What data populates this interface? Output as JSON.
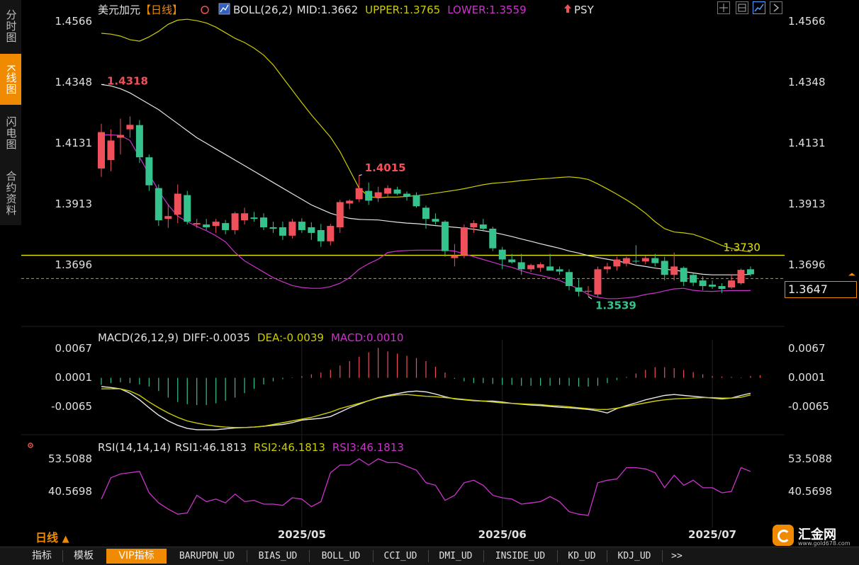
{
  "sidebar": {
    "tabs": [
      {
        "label": "分时图",
        "active": false
      },
      {
        "label": "K线图",
        "active": true
      },
      {
        "label": "闪电图",
        "active": false
      },
      {
        "label": "合约资料",
        "active": false
      }
    ]
  },
  "header": {
    "symbol": "美元加元",
    "period_tag": "【日线】",
    "boll_label": "BOLL(26,2)",
    "mid_label": "MID:1.3662",
    "upper_label": "UPPER:1.3765",
    "lower_label": "LOWER:1.3559",
    "psy_label": "PSY"
  },
  "colors": {
    "up": "#f0505a",
    "down": "#36c28c",
    "mid": "#e6e6e6",
    "upper": "#cccc00",
    "lower": "#cc33cc",
    "accent": "#f08a00",
    "hline": "#e6e600"
  },
  "chart_data": [
    {
      "type": "candlestick",
      "title": "美元加元【日线】",
      "y_ticks": [
        "1.4566",
        "1.4348",
        "1.4131",
        "1.3913",
        "1.3696"
      ],
      "ylim": [
        1.3505,
        1.4617
      ],
      "x_tick_labels": [
        "2025/05",
        "2025/06",
        "2025/07"
      ],
      "x_tick_index": [
        21,
        42,
        64
      ],
      "candles": [
        {
          "o": 1.404,
          "h": 1.42,
          "l": 1.401,
          "c": 1.417
        },
        {
          "o": 1.407,
          "h": 1.418,
          "l": 1.403,
          "c": 1.414
        },
        {
          "o": 1.415,
          "h": 1.4218,
          "l": 1.409,
          "c": 1.416
        },
        {
          "o": 1.418,
          "h": 1.4226,
          "l": 1.415,
          "c": 1.4196
        },
        {
          "o": 1.4195,
          "h": 1.4213,
          "l": 1.406,
          "c": 1.408
        },
        {
          "o": 1.408,
          "h": 1.409,
          "l": 1.396,
          "c": 1.398
        },
        {
          "o": 1.397,
          "h": 1.3983,
          "l": 1.3835,
          "c": 1.3855
        },
        {
          "o": 1.386,
          "h": 1.3912,
          "l": 1.3828,
          "c": 1.387
        },
        {
          "o": 1.3875,
          "h": 1.3983,
          "l": 1.3845,
          "c": 1.395
        },
        {
          "o": 1.3945,
          "h": 1.396,
          "l": 1.384,
          "c": 1.385
        },
        {
          "o": 1.384,
          "h": 1.386,
          "l": 1.3828,
          "c": 1.3845
        },
        {
          "o": 1.384,
          "h": 1.386,
          "l": 1.382,
          "c": 1.383
        },
        {
          "o": 1.3835,
          "h": 1.386,
          "l": 1.381,
          "c": 1.385
        },
        {
          "o": 1.3845,
          "h": 1.3856,
          "l": 1.3805,
          "c": 1.382
        },
        {
          "o": 1.382,
          "h": 1.3885,
          "l": 1.3805,
          "c": 1.388
        },
        {
          "o": 1.3855,
          "h": 1.39,
          "l": 1.384,
          "c": 1.388
        },
        {
          "o": 1.3865,
          "h": 1.3885,
          "l": 1.385,
          "c": 1.386
        },
        {
          "o": 1.3865,
          "h": 1.388,
          "l": 1.382,
          "c": 1.383
        },
        {
          "o": 1.383,
          "h": 1.385,
          "l": 1.381,
          "c": 1.3825
        },
        {
          "o": 1.383,
          "h": 1.385,
          "l": 1.3785,
          "c": 1.38
        },
        {
          "o": 1.38,
          "h": 1.386,
          "l": 1.379,
          "c": 1.385
        },
        {
          "o": 1.385,
          "h": 1.3862,
          "l": 1.381,
          "c": 1.382
        },
        {
          "o": 1.383,
          "h": 1.3848,
          "l": 1.3785,
          "c": 1.381
        },
        {
          "o": 1.382,
          "h": 1.3842,
          "l": 1.376,
          "c": 1.378
        },
        {
          "o": 1.378,
          "h": 1.3842,
          "l": 1.3765,
          "c": 1.3835
        },
        {
          "o": 1.383,
          "h": 1.3928,
          "l": 1.381,
          "c": 1.392
        },
        {
          "o": 1.3915,
          "h": 1.393,
          "l": 1.3895,
          "c": 1.3925
        },
        {
          "o": 1.393,
          "h": 1.4015,
          "l": 1.392,
          "c": 1.397
        },
        {
          "o": 1.396,
          "h": 1.399,
          "l": 1.391,
          "c": 1.3925
        },
        {
          "o": 1.3935,
          "h": 1.3975,
          "l": 1.392,
          "c": 1.3955
        },
        {
          "o": 1.395,
          "h": 1.398,
          "l": 1.394,
          "c": 1.397
        },
        {
          "o": 1.3965,
          "h": 1.3975,
          "l": 1.3945,
          "c": 1.395
        },
        {
          "o": 1.395,
          "h": 1.3958,
          "l": 1.3925,
          "c": 1.394
        },
        {
          "o": 1.3945,
          "h": 1.3955,
          "l": 1.39,
          "c": 1.3905
        },
        {
          "o": 1.39,
          "h": 1.3908,
          "l": 1.3825,
          "c": 1.386
        },
        {
          "o": 1.386,
          "h": 1.388,
          "l": 1.384,
          "c": 1.385
        },
        {
          "o": 1.385,
          "h": 1.3855,
          "l": 1.3725,
          "c": 1.3745
        },
        {
          "o": 1.372,
          "h": 1.377,
          "l": 1.369,
          "c": 1.373
        },
        {
          "o": 1.373,
          "h": 1.384,
          "l": 1.372,
          "c": 1.383
        },
        {
          "o": 1.383,
          "h": 1.3855,
          "l": 1.381,
          "c": 1.3845
        },
        {
          "o": 1.384,
          "h": 1.386,
          "l": 1.3815,
          "c": 1.3825
        },
        {
          "o": 1.3825,
          "h": 1.3832,
          "l": 1.3745,
          "c": 1.3755
        },
        {
          "o": 1.375,
          "h": 1.376,
          "l": 1.368,
          "c": 1.3715
        },
        {
          "o": 1.3715,
          "h": 1.3735,
          "l": 1.37,
          "c": 1.3705
        },
        {
          "o": 1.3705,
          "h": 1.3735,
          "l": 1.366,
          "c": 1.368
        },
        {
          "o": 1.368,
          "h": 1.37,
          "l": 1.367,
          "c": 1.3695
        },
        {
          "o": 1.3685,
          "h": 1.3705,
          "l": 1.367,
          "c": 1.3698
        },
        {
          "o": 1.369,
          "h": 1.3735,
          "l": 1.368,
          "c": 1.3675
        },
        {
          "o": 1.368,
          "h": 1.369,
          "l": 1.366,
          "c": 1.3672
        },
        {
          "o": 1.367,
          "h": 1.368,
          "l": 1.3605,
          "c": 1.362
        },
        {
          "o": 1.3615,
          "h": 1.3645,
          "l": 1.3583,
          "c": 1.36
        },
        {
          "o": 1.36,
          "h": 1.362,
          "l": 1.3585,
          "c": 1.3603
        },
        {
          "o": 1.359,
          "h": 1.369,
          "l": 1.358,
          "c": 1.368
        },
        {
          "o": 1.368,
          "h": 1.3703,
          "l": 1.3665,
          "c": 1.369
        },
        {
          "o": 1.369,
          "h": 1.3725,
          "l": 1.3675,
          "c": 1.3715
        },
        {
          "o": 1.37,
          "h": 1.3725,
          "l": 1.369,
          "c": 1.372
        },
        {
          "o": 1.371,
          "h": 1.3766,
          "l": 1.37,
          "c": 1.3708
        },
        {
          "o": 1.3708,
          "h": 1.3728,
          "l": 1.3698,
          "c": 1.372
        },
        {
          "o": 1.372,
          "h": 1.3735,
          "l": 1.369,
          "c": 1.3702
        },
        {
          "o": 1.371,
          "h": 1.3725,
          "l": 1.364,
          "c": 1.366
        },
        {
          "o": 1.366,
          "h": 1.374,
          "l": 1.364,
          "c": 1.369
        },
        {
          "o": 1.3685,
          "h": 1.369,
          "l": 1.362,
          "c": 1.3635
        },
        {
          "o": 1.366,
          "h": 1.3665,
          "l": 1.362,
          "c": 1.3632
        },
        {
          "o": 1.364,
          "h": 1.3655,
          "l": 1.3605,
          "c": 1.362
        },
        {
          "o": 1.3625,
          "h": 1.364,
          "l": 1.361,
          "c": 1.3618
        },
        {
          "o": 1.362,
          "h": 1.363,
          "l": 1.3595,
          "c": 1.361
        },
        {
          "o": 1.3615,
          "h": 1.366,
          "l": 1.361,
          "c": 1.364
        },
        {
          "o": 1.363,
          "h": 1.3682,
          "l": 1.3625,
          "c": 1.3678
        },
        {
          "o": 1.368,
          "h": 1.369,
          "l": 1.3655,
          "c": 1.3662
        }
      ],
      "boll_mid": [
        1.434,
        1.4335,
        1.4325,
        1.431,
        1.429,
        1.427,
        1.425,
        1.4225,
        1.42,
        1.4175,
        1.415,
        1.413,
        1.411,
        1.409,
        1.407,
        1.405,
        1.403,
        1.401,
        1.399,
        1.397,
        1.395,
        1.393,
        1.391,
        1.3895,
        1.388,
        1.387,
        1.3862,
        1.3858,
        1.3857,
        1.3856,
        1.3852,
        1.3848,
        1.3845,
        1.3843,
        1.384,
        1.3836,
        1.3833,
        1.383,
        1.3827,
        1.3823,
        1.3818,
        1.3812,
        1.3805,
        1.3797,
        1.3788,
        1.378,
        1.3771,
        1.3763,
        1.3755,
        1.3745,
        1.3738,
        1.3729,
        1.3722,
        1.3716,
        1.371,
        1.3703,
        1.3695,
        1.369,
        1.3684,
        1.368,
        1.3677,
        1.3672,
        1.3667,
        1.3662,
        1.366,
        1.366,
        1.366,
        1.366,
        1.3662
      ],
      "boll_upper": [
        1.4523,
        1.452,
        1.4513,
        1.45,
        1.4495,
        1.451,
        1.453,
        1.4555,
        1.457,
        1.4573,
        1.4568,
        1.456,
        1.4545,
        1.4525,
        1.4505,
        1.449,
        1.447,
        1.4445,
        1.441,
        1.4365,
        1.432,
        1.4275,
        1.4232,
        1.4192,
        1.4152,
        1.41,
        1.4035,
        1.397,
        1.394,
        1.3935,
        1.3938,
        1.3938,
        1.394,
        1.3943,
        1.3947,
        1.3952,
        1.3957,
        1.3962,
        1.3968,
        1.3975,
        1.3982,
        1.3987,
        1.399,
        1.3993,
        1.3997,
        1.4,
        1.4003,
        1.4005,
        1.4008,
        1.401,
        1.4007,
        1.4001,
        1.3985,
        1.3967,
        1.3948,
        1.3928,
        1.3906,
        1.388,
        1.385,
        1.3825,
        1.3813,
        1.381,
        1.3805,
        1.3793,
        1.378,
        1.3765,
        1.3755,
        1.3747,
        1.3742
      ],
      "boll_lower": [
        1.416,
        1.416,
        1.4158,
        1.414,
        1.408,
        1.402,
        1.396,
        1.391,
        1.387,
        1.385,
        1.3833,
        1.3818,
        1.38,
        1.3778,
        1.374,
        1.371,
        1.369,
        1.367,
        1.365,
        1.3635,
        1.3622,
        1.3615,
        1.3612,
        1.3612,
        1.3618,
        1.363,
        1.365,
        1.368,
        1.37,
        1.3716,
        1.374,
        1.3745,
        1.3747,
        1.3748,
        1.3748,
        1.3748,
        1.3748,
        1.3745,
        1.3735,
        1.3725,
        1.3715,
        1.3705,
        1.3695,
        1.3687,
        1.3675,
        1.3665,
        1.3658,
        1.365,
        1.364,
        1.3625,
        1.361,
        1.359,
        1.358,
        1.3575,
        1.3575,
        1.3578,
        1.3582,
        1.359,
        1.3595,
        1.3603,
        1.361,
        1.3612,
        1.3605,
        1.3602,
        1.3601,
        1.3603,
        1.3604,
        1.3604,
        1.3604
      ],
      "hline": 1.373,
      "hline_label": "1.3730",
      "last_price": 1.3647,
      "last_price_label": "1.3647",
      "high_label": "1.4318",
      "high_point": {
        "index": 0,
        "value": 1.434
      },
      "mid_high_label": "1.4015",
      "mid_high_point": {
        "index": 27,
        "value": 1.4015
      },
      "low_label": "1.3539",
      "low_point": {
        "index": 51,
        "value": 1.3583
      }
    },
    {
      "type": "bar+line",
      "title": "MACD(26,12,9)",
      "diff_label": "DIFF:-0.0035",
      "dea_label": "DEA:-0.0039",
      "macd_label": "MACD:0.0010",
      "y_ticks": [
        "0.0067",
        "0.0001",
        "-0.0065"
      ],
      "ylim": [
        -0.013,
        0.0067
      ],
      "macd": [
        -0.0016,
        -0.0012,
        -0.001,
        -0.0012,
        -0.0015,
        -0.002,
        -0.003,
        -0.0045,
        -0.0055,
        -0.006,
        -0.0062,
        -0.0062,
        -0.0058,
        -0.0052,
        -0.0045,
        -0.0035,
        -0.0025,
        -0.0015,
        -0.0008,
        -0.0003,
        0.0001,
        0.0004,
        0.0008,
        0.0012,
        0.0018,
        0.0028,
        0.0038,
        0.0048,
        0.0058,
        0.0068,
        0.006,
        0.0055,
        0.005,
        0.0045,
        0.0038,
        0.0025,
        0.0012,
        -0.0002,
        -0.0008,
        -0.0012,
        -0.0012,
        -0.0014,
        -0.0016,
        -0.0016,
        -0.0018,
        -0.0018,
        -0.0018,
        -0.0018,
        -0.0016,
        -0.0018,
        -0.002,
        -0.002,
        -0.0018,
        -0.0012,
        -0.0005,
        0.0002,
        0.001,
        0.0018,
        0.0024,
        0.0024,
        0.0022,
        0.0018,
        0.0013,
        0.0008,
        0.0004,
        0.0003,
        0.0002,
        0.0001,
        0.0004,
        0.0006
      ],
      "diff": [
        -0.002,
        -0.0022,
        -0.0025,
        -0.0035,
        -0.005,
        -0.0068,
        -0.0085,
        -0.0098,
        -0.0108,
        -0.0115,
        -0.0118,
        -0.0118,
        -0.0118,
        -0.0116,
        -0.0114,
        -0.0113,
        -0.0112,
        -0.011,
        -0.0108,
        -0.0106,
        -0.0102,
        -0.0096,
        -0.0094,
        -0.0092,
        -0.0088,
        -0.0078,
        -0.0068,
        -0.006,
        -0.0052,
        -0.0045,
        -0.004,
        -0.0036,
        -0.0032,
        -0.003,
        -0.0032,
        -0.0037,
        -0.0043,
        -0.0048,
        -0.005,
        -0.0052,
        -0.0053,
        -0.0053,
        -0.0055,
        -0.0058,
        -0.006,
        -0.0062,
        -0.0063,
        -0.0065,
        -0.0067,
        -0.0068,
        -0.007,
        -0.0072,
        -0.0075,
        -0.008,
        -0.007,
        -0.0063,
        -0.0057,
        -0.005,
        -0.0045,
        -0.004,
        -0.0038,
        -0.004,
        -0.0042,
        -0.0044,
        -0.0046,
        -0.0048,
        -0.0046,
        -0.004,
        -0.0035
      ],
      "dea": [
        -0.0025,
        -0.0025,
        -0.0025,
        -0.003,
        -0.004,
        -0.0055,
        -0.0068,
        -0.008,
        -0.009,
        -0.0098,
        -0.0103,
        -0.0107,
        -0.011,
        -0.0112,
        -0.0113,
        -0.0113,
        -0.0112,
        -0.011,
        -0.0106,
        -0.0102,
        -0.0098,
        -0.0094,
        -0.009,
        -0.0084,
        -0.0078,
        -0.007,
        -0.0064,
        -0.0058,
        -0.0052,
        -0.0046,
        -0.0042,
        -0.0039,
        -0.0038,
        -0.004,
        -0.0042,
        -0.0043,
        -0.0045,
        -0.0047,
        -0.0049,
        -0.0051,
        -0.0053,
        -0.0055,
        -0.0057,
        -0.0058,
        -0.0059,
        -0.006,
        -0.0061,
        -0.0063,
        -0.0064,
        -0.0066,
        -0.0068,
        -0.007,
        -0.0072,
        -0.0072,
        -0.0069,
        -0.0065,
        -0.0061,
        -0.0057,
        -0.0053,
        -0.005,
        -0.0048,
        -0.0047,
        -0.0046,
        -0.0045,
        -0.0045,
        -0.0046,
        -0.0046,
        -0.0044,
        -0.0039
      ]
    },
    {
      "type": "line",
      "title": "RSI(14,14,14)",
      "rsi1_label": "RSI1:46.1813",
      "rsi2_label": "RSI2:46.1813",
      "rsi3_label": "RSI3:46.1813",
      "y_ticks": [
        "53.5088",
        "40.5698"
      ],
      "ylim": [
        25.5,
        57.0
      ],
      "rsi": [
        37.5,
        46,
        47.5,
        48,
        48.5,
        40,
        36,
        33.5,
        31.5,
        32,
        39,
        36.5,
        37.5,
        36,
        39.5,
        36.5,
        37,
        35.5,
        35.5,
        35,
        38,
        37.5,
        34.5,
        36.5,
        48,
        51,
        51,
        53.5,
        51,
        53.5,
        52,
        52,
        50.5,
        49,
        44,
        43,
        37,
        39,
        44,
        45,
        43,
        39,
        38,
        37.5,
        35.5,
        36,
        36.5,
        38.5,
        36.5,
        32.5,
        31.5,
        31,
        44,
        45,
        45.5,
        50,
        50,
        49.5,
        48,
        42,
        47,
        43,
        45,
        42,
        42,
        40,
        40.5,
        50,
        48.5
      ]
    }
  ],
  "bottom_tabs": {
    "period": "日线",
    "period_arrow": "▲",
    "items": [
      "指标",
      "模板",
      "VIP指标",
      "BARUPDN_UD",
      "BIAS_UD",
      "BOLL_UD",
      "CCI_UD",
      "DMI_UD",
      "INSIDE_UD",
      "KD_UD",
      "KDJ_UD",
      ">>"
    ]
  },
  "toolbar_icons": [
    "crosshair-icon",
    "chart-settings-icon",
    "chart-type-icon",
    "expand-icon"
  ],
  "logo": {
    "name": "汇金网",
    "url": "www.gold678.com"
  }
}
